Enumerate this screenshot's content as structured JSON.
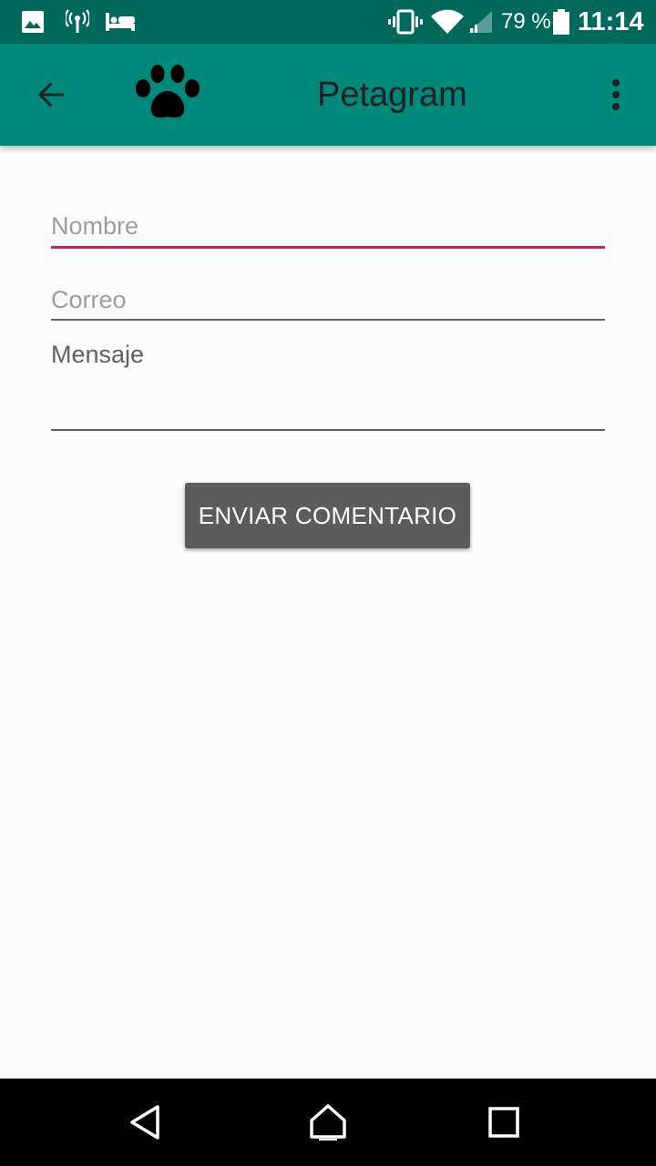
{
  "status_bar": {
    "battery_text": "79 %",
    "time": "11:14",
    "icons": [
      "image-icon",
      "hotspot-icon",
      "bed-icon",
      "vibrate-icon",
      "wifi-icon",
      "signal-icon",
      "battery-icon"
    ],
    "background": "#00695c"
  },
  "app_bar": {
    "title": "Petagram",
    "back_icon": "arrow-back-icon",
    "logo_icon": "paw-icon",
    "menu_icon": "more-vert-icon",
    "background": "#00897b"
  },
  "form": {
    "nombre_placeholder": "Nombre",
    "correo_placeholder": "Correo",
    "mensaje_placeholder": "Mensaje",
    "focus_color": "#d81b60"
  },
  "send_button": {
    "label": "ENVIAR COMENTARIO"
  },
  "nav_bar": {
    "icons": [
      "nav-back-icon",
      "nav-home-icon",
      "nav-recents-icon"
    ]
  }
}
